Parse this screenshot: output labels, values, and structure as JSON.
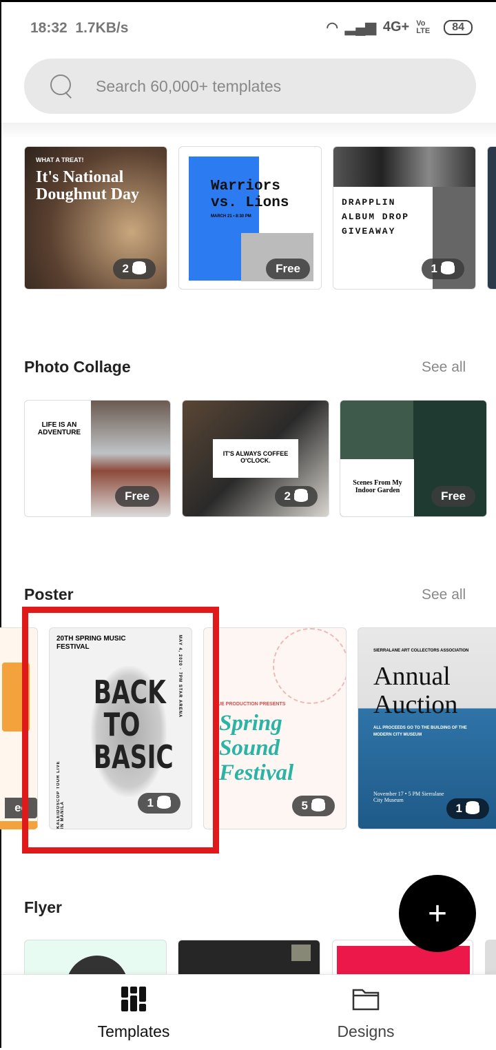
{
  "status": {
    "time": "18:32",
    "speed": "1.7KB/s",
    "network": "4G+",
    "volte": "Vo LTE",
    "battery": "84"
  },
  "search": {
    "placeholder": "Search 60,000+ templates"
  },
  "row1": [
    {
      "lines": [
        "WHAT A TREAT!",
        "It's National Doughnut Day"
      ],
      "badge": "2",
      "bg": "#4a3a2c"
    },
    {
      "lines": [
        "Warriors vs. Lions",
        "MARCH 21 • 8:30 PM"
      ],
      "badge": "Free",
      "bg": "#ffffff",
      "accent": "#2d7bf0"
    },
    {
      "lines": [
        "DRAPPLIN ALBUM DROP GIVEAWAY"
      ],
      "badge": "1",
      "bg": "#ffffff"
    }
  ],
  "photo_collage": {
    "title": "Photo Collage",
    "see_all": "See all",
    "cards": [
      {
        "lines": [
          "LIFE IS AN ADVENTURE"
        ],
        "badge": "Free"
      },
      {
        "lines": [
          "IT'S ALWAYS COFFEE O'CLOCK."
        ],
        "badge": "2"
      },
      {
        "lines": [
          "Scenes From My Indoor Garden"
        ],
        "badge": "Free"
      }
    ]
  },
  "poster": {
    "title": "Poster",
    "see_all": "See all",
    "partial_badge": "ee",
    "cards": [
      {
        "top": "20TH SPRING MUSIC FESTIVAL",
        "main": "BACK TO BASIC",
        "side": "MAY 4, 2020 · 7PM STAR ARENA",
        "bottom": "KALEIDOSCOP TOUR LIVE IN MANILA",
        "badge": "1"
      },
      {
        "top": "UE PRODUCTION PRESENTS",
        "main": "Spring Sound Festival",
        "badge": "5",
        "accent": "#2bb3a3"
      },
      {
        "top": "SIERRALANE ART COLLECTORS ASSOCIATION",
        "main": "Annual Auction",
        "sub": "ALL PROCEEDS GO TO THE BUILDING OF THE MODERN CITY MUSEUM",
        "bottom": "November 17 • 5 PM Sierralane City Museum",
        "badge": "1"
      }
    ]
  },
  "flyer": {
    "title": "Flyer"
  },
  "fab": {
    "label": "+"
  },
  "nav": {
    "items": [
      {
        "label": "Templates",
        "icon": "templates-grid-icon",
        "active": true
      },
      {
        "label": "Designs",
        "icon": "folder-icon",
        "active": false
      }
    ]
  },
  "colors": {
    "highlight": "#e0191b",
    "fab": "#000000"
  }
}
